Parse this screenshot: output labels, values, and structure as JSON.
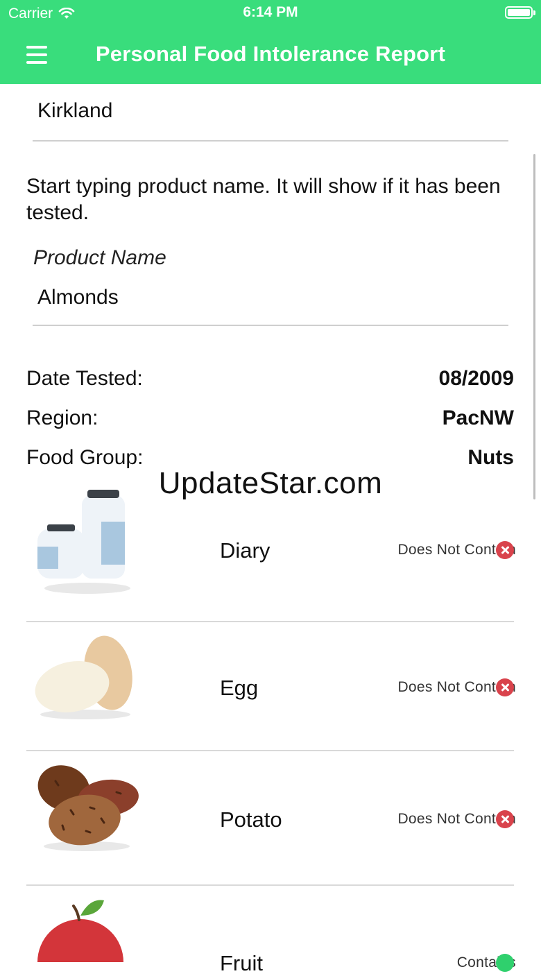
{
  "status_bar": {
    "carrier": "Carrier",
    "time": "6:14 PM"
  },
  "nav": {
    "title": "Personal Food Intolerance Report",
    "menu_icon": "hamburger-menu-icon"
  },
  "brand_input": {
    "value": "Kirkland"
  },
  "helper_text": "Start typing product name. It will show if it has been tested.",
  "product_name": {
    "label": "Product Name",
    "value": "Almonds"
  },
  "details": [
    {
      "label": "Date Tested:",
      "value": "08/2009"
    },
    {
      "label": "Region:",
      "value": "PacNW"
    },
    {
      "label": "Food Group:",
      "value": "Nuts"
    }
  ],
  "watermark": "UpdateStar.com",
  "allergens": [
    {
      "name": "Diary",
      "status": "Does Not Contain",
      "icon": "milk-bottles-icon",
      "status_icon": "red-x-circle-icon"
    },
    {
      "name": "Egg",
      "status": "Does Not Contain",
      "icon": "eggs-icon",
      "status_icon": "red-x-circle-icon"
    },
    {
      "name": "Potato",
      "status": "Does Not Contain",
      "icon": "potatoes-icon",
      "status_icon": "red-x-circle-icon"
    },
    {
      "name": "Fruit",
      "status": "Contains",
      "icon": "apple-icon",
      "status_icon": "green-circle-icon"
    }
  ],
  "colors": {
    "header_green": "#39dd7c",
    "not_contain_red": "#d9434c",
    "contains_green": "#2fd06d"
  }
}
